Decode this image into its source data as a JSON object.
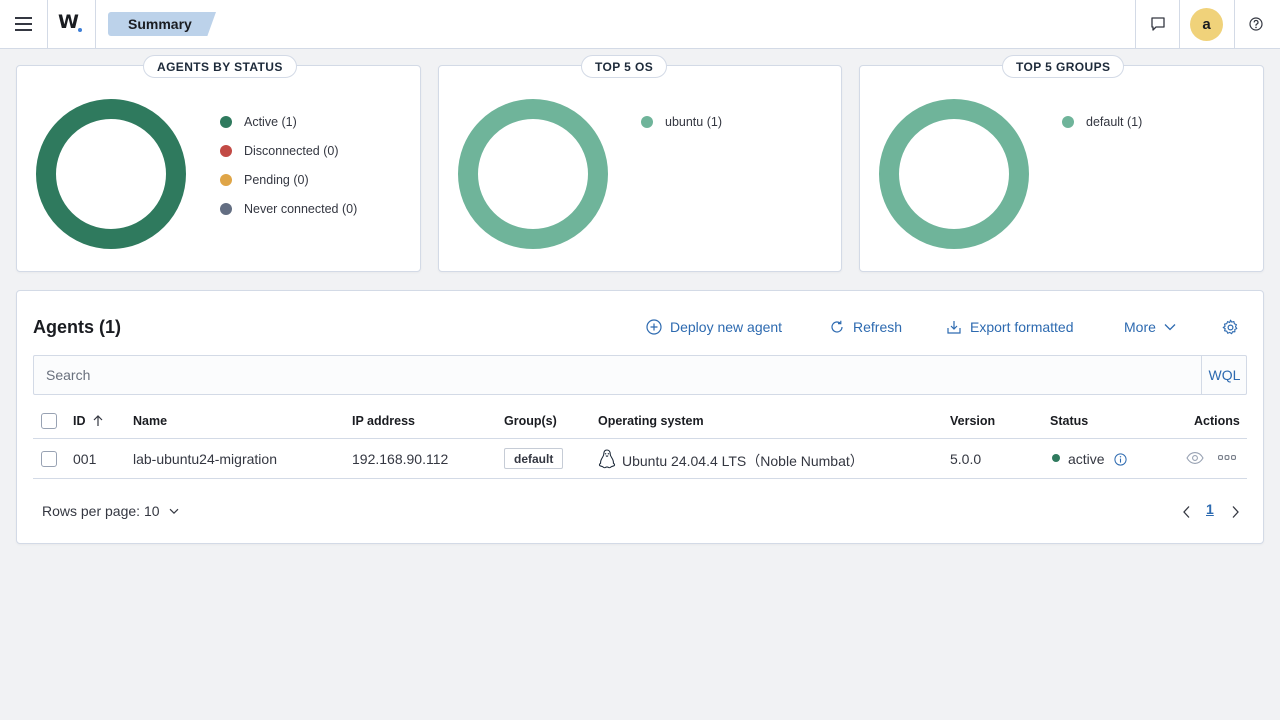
{
  "header": {
    "logo_text": "W",
    "breadcrumb": "Summary",
    "avatar_initial": "a"
  },
  "colors": {
    "active": "#2f7a5e",
    "disconnected": "#c24a45",
    "pending": "#dfa547",
    "never_connected": "#636e82",
    "light_green": "#6fb49a",
    "link": "#2d6ab0"
  },
  "status_panel": {
    "title": "AGENTS BY STATUS",
    "legend": [
      {
        "label": "Active (1)",
        "color": "#2f7a5e"
      },
      {
        "label": "Disconnected (0)",
        "color": "#c24a45"
      },
      {
        "label": "Pending (0)",
        "color": "#dfa547"
      },
      {
        "label": "Never connected (0)",
        "color": "#636e82"
      }
    ]
  },
  "os_panel": {
    "title": "TOP 5 OS",
    "legend": [
      {
        "label": "ubuntu (1)",
        "color": "#6fb49a"
      }
    ]
  },
  "groups_panel": {
    "title": "TOP 5 GROUPS",
    "legend": [
      {
        "label": "default (1)",
        "color": "#6fb49a"
      }
    ]
  },
  "agents": {
    "title": "Agents (1)",
    "actions": {
      "deploy": "Deploy new agent",
      "refresh": "Refresh",
      "export": "Export formatted",
      "more": "More"
    },
    "search_placeholder": "Search",
    "wql": "WQL",
    "columns": {
      "id": "ID",
      "name": "Name",
      "ip": "IP address",
      "groups": "Group(s)",
      "os": "Operating system",
      "version": "Version",
      "status": "Status",
      "actions": "Actions"
    },
    "rows": [
      {
        "id": "001",
        "name": "lab-ubuntu24-migration",
        "ip": "192.168.90.112",
        "group": "default",
        "os": "Ubuntu 24.04.4 LTS（Noble Numbat）",
        "version": "5.0.0",
        "status": "active"
      }
    ],
    "rows_per_page": "Rows per page: 10",
    "current_page": "1"
  }
}
